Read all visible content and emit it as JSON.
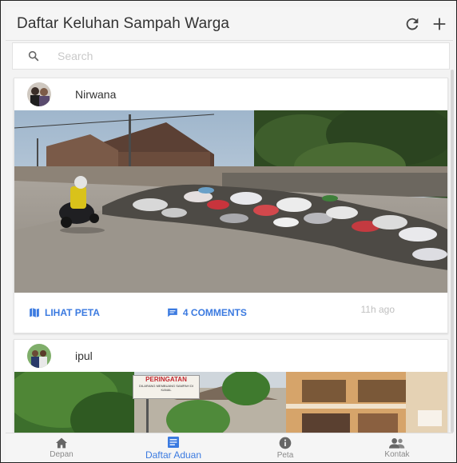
{
  "header": {
    "title": "Daftar Keluhan Sampah Warga",
    "refresh_icon": "refresh-icon",
    "add_icon": "plus-icon"
  },
  "search": {
    "placeholder": "Search",
    "value": ""
  },
  "posts": [
    {
      "user": "Nirwana",
      "photo": "roadside garbage pile with motorcyclist",
      "actions": {
        "map_label": "LIHAT PETA",
        "comments_label": "4 COMMENTS"
      },
      "time": "11h ago"
    },
    {
      "user": "ipul",
      "photo": "street with warning sign and buildings",
      "sign_title": "PERINGATAN",
      "sign_lines": "DILARANG MEMBUANG SAMPAH DI KANAL"
    }
  ],
  "tabs": [
    {
      "label": "Depan",
      "icon": "home-icon"
    },
    {
      "label": "Daftar Aduan",
      "icon": "list-icon",
      "active": true
    },
    {
      "label": "Peta",
      "icon": "info-icon"
    },
    {
      "label": "Kontak",
      "icon": "contacts-icon"
    }
  ],
  "colors": {
    "accent": "#3b7ae0",
    "header_bg": "#f5f5f5",
    "muted": "#8a8a8a"
  }
}
